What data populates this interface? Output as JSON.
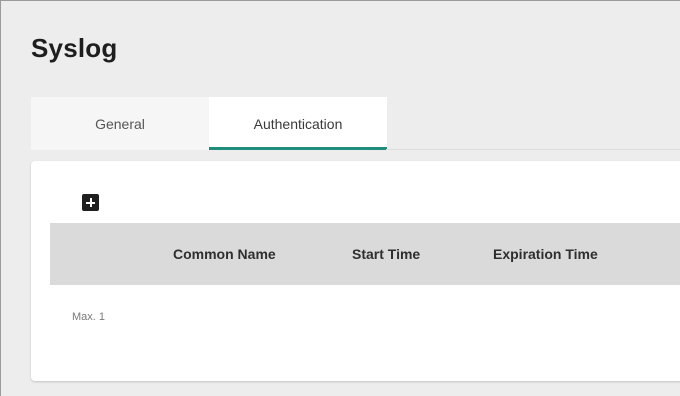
{
  "page": {
    "title": "Syslog"
  },
  "tabs": [
    {
      "label": "General",
      "active": false
    },
    {
      "label": "Authentication",
      "active": true
    }
  ],
  "certificates_table": {
    "add_button_icon": "plus-icon",
    "columns": [
      "Common Name",
      "Start Time",
      "Expiration Time"
    ],
    "rows": [],
    "limit_text": "Max. 1"
  },
  "colors": {
    "accent": "#1f8c7c",
    "table_header_bg": "#dadada",
    "page_bg": "#ededed"
  }
}
